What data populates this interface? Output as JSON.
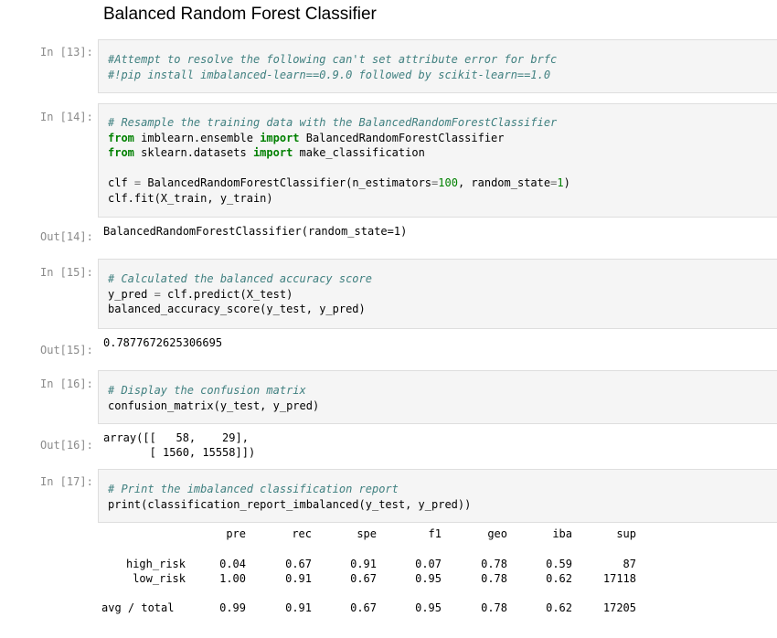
{
  "heading": "Balanced Random Forest Classifier",
  "cells": {
    "c13": {
      "in_prompt": "In [13]:",
      "lines": [
        "#Attempt to resolve the following can't set attribute error for brfc",
        "#!pip install imbalanced-learn==0.9.0 followed by scikit-learn==1.0"
      ]
    },
    "c14": {
      "in_prompt": "In [14]:",
      "comment": "# Resample the training data with the BalancedRandomForestClassifier",
      "imp1_from": "from",
      "imp1_mod": " imblearn.ensemble ",
      "imp1_import": "import",
      "imp1_name": " BalancedRandomForestClassifier",
      "imp2_from": "from",
      "imp2_mod": " sklearn.datasets ",
      "imp2_import": "import",
      "imp2_name": " make_classification",
      "line_clf_a": "clf ",
      "line_clf_eq": "=",
      "line_clf_b": " BalancedRandomForestClassifier(n_estimators",
      "line_clf_eq2": "=",
      "line_clf_n1": "100",
      "line_clf_c": ", random_state",
      "line_clf_eq3": "=",
      "line_clf_n2": "1",
      "line_clf_d": ")",
      "line_fit": "clf.fit(X_train, y_train)",
      "out_prompt": "Out[14]:",
      "output": "BalancedRandomForestClassifier(random_state=1)"
    },
    "c15": {
      "in_prompt": "In [15]:",
      "comment": "# Calculated the balanced accuracy score",
      "line1_a": "y_pred ",
      "line1_eq": "=",
      "line1_b": " clf.predict(X_test)",
      "line2": "balanced_accuracy_score(y_test, y_pred)",
      "out_prompt": "Out[15]:",
      "output": "0.7877672625306695"
    },
    "c16": {
      "in_prompt": "In [16]:",
      "comment": "# Display the confusion matrix",
      "line1": "confusion_matrix(y_test, y_pred)",
      "out_prompt": "Out[16]:",
      "output_line1": "array([[   58,    29],",
      "output_line2": "       [ 1560, 15558]])"
    },
    "c17": {
      "in_prompt": "In [17]:",
      "comment": "# Print the imbalanced classification report",
      "line1": "print(classification_report_imbalanced(y_test, y_pred))"
    }
  },
  "report": {
    "columns": [
      "pre",
      "rec",
      "spe",
      "f1",
      "geo",
      "iba",
      "sup"
    ],
    "rows": [
      {
        "label": "high_risk",
        "values": [
          "0.04",
          "0.67",
          "0.91",
          "0.07",
          "0.78",
          "0.59",
          "87"
        ]
      },
      {
        "label": "low_risk",
        "values": [
          "1.00",
          "0.91",
          "0.67",
          "0.95",
          "0.78",
          "0.62",
          "17118"
        ]
      }
    ],
    "total": {
      "label": "avg / total",
      "values": [
        "0.99",
        "0.91",
        "0.67",
        "0.95",
        "0.78",
        "0.62",
        "17205"
      ]
    }
  }
}
